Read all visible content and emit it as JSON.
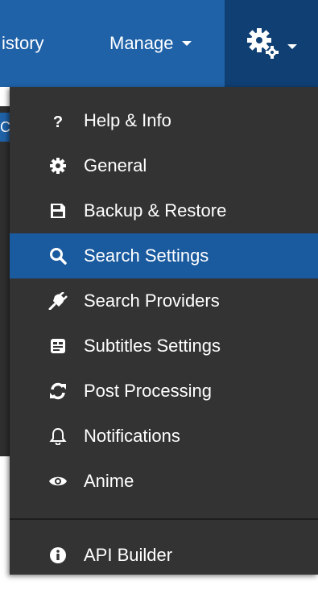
{
  "navbar": {
    "history_label": "istory",
    "manage_label": "Manage",
    "left_tab_text": "C"
  },
  "menu": {
    "items": [
      {
        "label": "Help & Info",
        "icon": "question-icon"
      },
      {
        "label": "General",
        "icon": "gear-icon"
      },
      {
        "label": "Backup & Restore",
        "icon": "floppy-disk-icon"
      },
      {
        "label": "Search Settings",
        "icon": "search-icon"
      },
      {
        "label": "Search Providers",
        "icon": "plug-icon"
      },
      {
        "label": "Subtitles Settings",
        "icon": "subtitles-icon"
      },
      {
        "label": "Post Processing",
        "icon": "refresh-icon"
      },
      {
        "label": "Notifications",
        "icon": "bell-icon"
      },
      {
        "label": "Anime",
        "icon": "eye-icon"
      },
      {
        "label": "API Builder",
        "icon": "info-circle-icon"
      }
    ],
    "active_item": "Search Settings"
  },
  "colors": {
    "navbar": "#1f62a8",
    "navbar_active": "#0f3f73",
    "menu_bg": "#333333",
    "menu_active": "#1a5a9e",
    "text": "#ffffff"
  }
}
